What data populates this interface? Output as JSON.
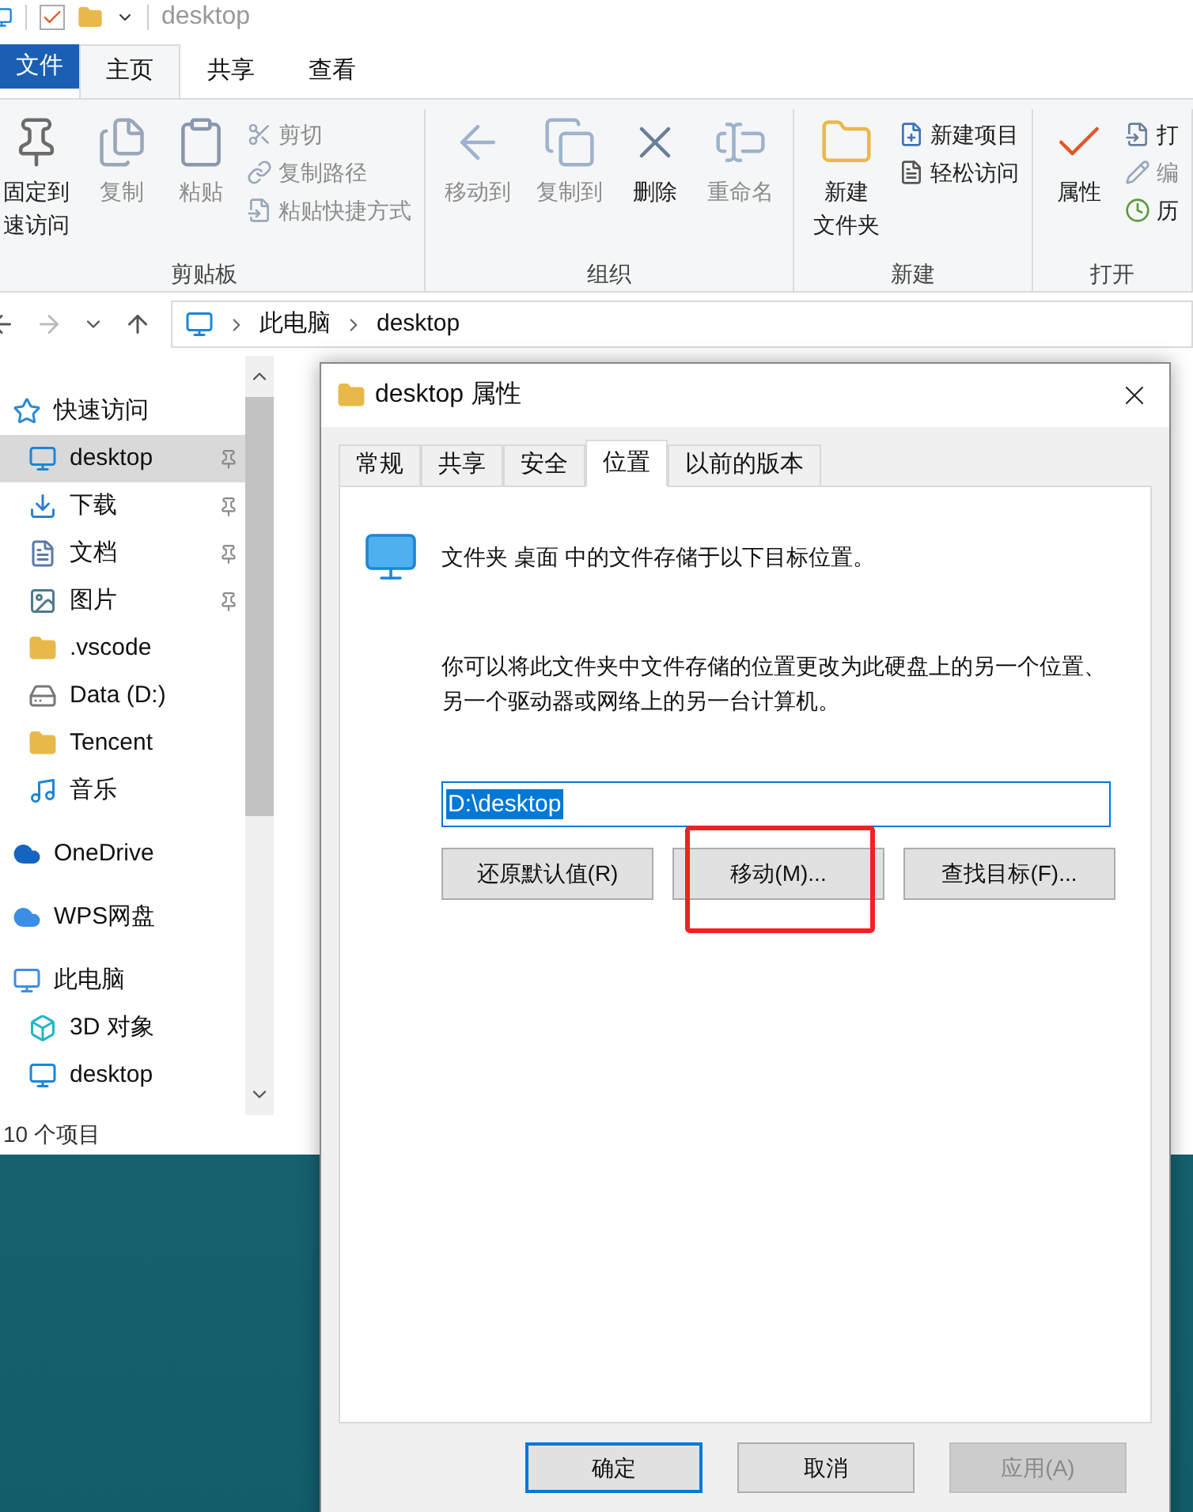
{
  "title_bar": {
    "title": "desktop"
  },
  "ribbon_tabs": [
    {
      "label": "文件",
      "kind": "file",
      "selected": false
    },
    {
      "label": "主页",
      "kind": "tab",
      "selected": true
    },
    {
      "label": "共享",
      "kind": "tab",
      "selected": false
    },
    {
      "label": "查看",
      "kind": "tab",
      "selected": false
    }
  ],
  "ribbon_groups": [
    {
      "label": "剪贴板",
      "items": [
        {
          "kind": "large",
          "lines": [
            "固定到",
            "速访问"
          ],
          "disabled": false
        },
        {
          "kind": "large",
          "lines": [
            "复制"
          ],
          "disabled": true
        },
        {
          "kind": "large",
          "lines": [
            "粘贴"
          ],
          "disabled": true
        },
        {
          "kind": "small",
          "lines": [
            "剪切"
          ],
          "disabled": true
        },
        {
          "kind": "small",
          "lines": [
            "复制路径"
          ],
          "disabled": true
        },
        {
          "kind": "small",
          "lines": [
            "粘贴快捷方式"
          ],
          "disabled": true
        }
      ]
    },
    {
      "label": "组织",
      "items": [
        {
          "kind": "large",
          "lines": [
            "移动到"
          ],
          "disabled": true
        },
        {
          "kind": "large",
          "lines": [
            "复制到"
          ],
          "disabled": true
        },
        {
          "kind": "large",
          "lines": [
            "删除"
          ],
          "disabled": false
        },
        {
          "kind": "large",
          "lines": [
            "重命名"
          ],
          "disabled": true
        }
      ]
    },
    {
      "label": "新建",
      "items": [
        {
          "kind": "large",
          "lines": [
            "新建",
            "文件夹"
          ],
          "disabled": false
        },
        {
          "kind": "small",
          "lines": [
            "新建项目"
          ],
          "disabled": false
        },
        {
          "kind": "small",
          "lines": [
            "轻松访问"
          ],
          "disabled": false
        }
      ]
    },
    {
      "label": "打开",
      "items": [
        {
          "kind": "large",
          "lines": [
            "属性"
          ],
          "disabled": false
        },
        {
          "kind": "small",
          "lines": [
            "打"
          ],
          "disabled": false
        },
        {
          "kind": "small",
          "lines": [
            "编"
          ],
          "disabled": true
        },
        {
          "kind": "small",
          "lines": [
            "历"
          ],
          "disabled": false
        }
      ]
    }
  ],
  "address_bar": {
    "crumbs": [
      "此电脑",
      "desktop"
    ]
  },
  "nav_pane": [
    {
      "label": "快速访问",
      "selected": false,
      "pinned": false,
      "children": [
        {
          "label": "desktop",
          "selected": true,
          "pinned": true
        },
        {
          "label": "下载",
          "selected": false,
          "pinned": true
        },
        {
          "label": "文档",
          "selected": false,
          "pinned": true
        },
        {
          "label": "图片",
          "selected": false,
          "pinned": true
        },
        {
          "label": ".vscode",
          "selected": false,
          "pinned": false
        },
        {
          "label": "Data (D:)",
          "selected": false,
          "pinned": false
        },
        {
          "label": "Tencent",
          "selected": false,
          "pinned": false
        },
        {
          "label": "音乐",
          "selected": false,
          "pinned": false
        }
      ]
    },
    {
      "label": "OneDrive",
      "selected": false,
      "pinned": false
    },
    {
      "label": "WPS网盘",
      "selected": false,
      "pinned": false
    },
    {
      "label": "此电脑",
      "selected": false,
      "pinned": false,
      "children": [
        {
          "label": "3D 对象",
          "selected": false,
          "pinned": false
        },
        {
          "label": "desktop",
          "selected": false,
          "pinned": false
        }
      ]
    }
  ],
  "status_bar": {
    "count": "10 个项目"
  },
  "dialog": {
    "title": "desktop 属性",
    "tabs": [
      {
        "label": "常规",
        "selected": false
      },
      {
        "label": "共享",
        "selected": false
      },
      {
        "label": "安全",
        "selected": false
      },
      {
        "label": "位置",
        "selected": true
      },
      {
        "label": "以前的版本",
        "selected": false
      }
    ],
    "summary": "文件夹 桌面 中的文件存储于以下目标位置。",
    "description": "你可以将此文件夹中文件存储的位置更改为此硬盘上的另一个位置、另一个驱动器或网络上的另一台计算机。",
    "path": {
      "value": "D:\\desktop"
    },
    "actions": [
      {
        "label": "还原默认值(R)",
        "highlighted": false
      },
      {
        "label": "移动(M)...",
        "highlighted": true
      },
      {
        "label": "查找目标(F)...",
        "highlighted": false
      }
    ],
    "footer": [
      {
        "label": "确定",
        "kind": "default",
        "disabled": false
      },
      {
        "label": "取消",
        "kind": "normal",
        "disabled": false
      },
      {
        "label": "应用(A)",
        "kind": "normal",
        "disabled": true
      }
    ]
  }
}
